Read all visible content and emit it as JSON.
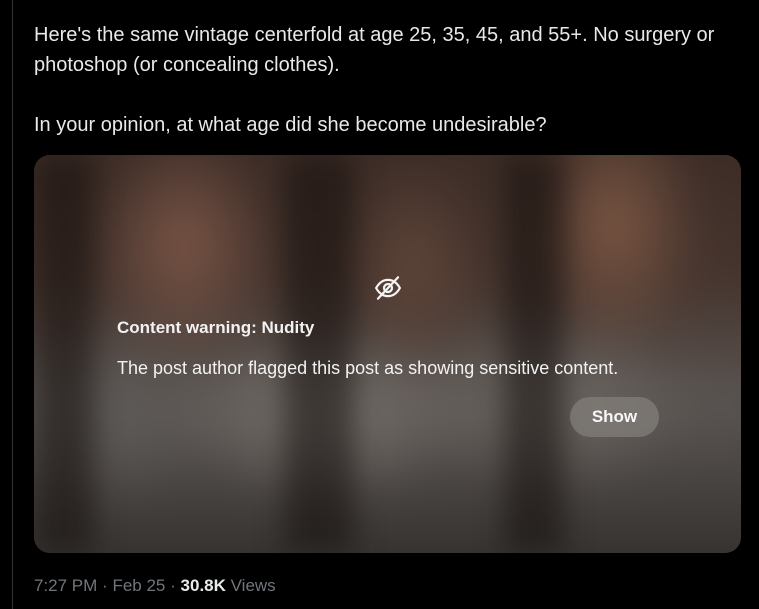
{
  "post": {
    "text_line1": "Here's the same vintage centerfold at age 25, 35, 45, and 55+. No surgery or photoshop (or concealing clothes).",
    "text_line2": "In your opinion, at what age did she become undesirable?"
  },
  "media": {
    "warning_icon": "eye-slash-icon",
    "warning_title": "Content warning: Nudity",
    "warning_description": "The post author flagged this post as showing sensitive content.",
    "show_label": "Show"
  },
  "meta": {
    "time": "7:27 PM",
    "separator1": "·",
    "date": "Feb 25",
    "separator2": "·",
    "views_count": "30.8K",
    "views_label": "Views"
  }
}
